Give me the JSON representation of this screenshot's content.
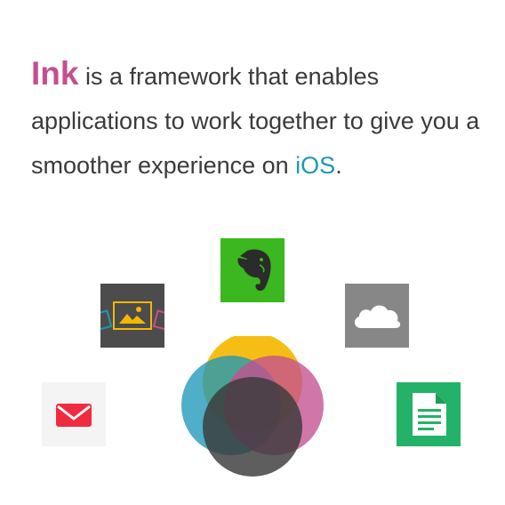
{
  "intro": {
    "brand": "Ink",
    "text_before": " is a framework that enables applications to work together to give you a smoother experience on ",
    "platform": "iOS",
    "text_after": "."
  },
  "apps": [
    {
      "icon": "evernote-elephant-icon"
    },
    {
      "icon": "photos-icon"
    },
    {
      "icon": "cloud-icon"
    },
    {
      "icon": "mail-envelope-icon"
    },
    {
      "icon": "document-icon"
    }
  ],
  "logo": {
    "icon": "ink-overlapping-circles-logo"
  },
  "colors": {
    "brand": "#c44f8f",
    "platform": "#1d97b8",
    "text": "#3a3a3a",
    "evernote": "#3bb71f",
    "photos": "#4c4c4c",
    "cloud": "#878787",
    "mail": "#f4f4f4",
    "docs": "#23b267",
    "circle_yellow": "#f5b800",
    "circle_blue": "#1d97b8",
    "circle_pink": "#c44f8f",
    "circle_gray": "#4a4a4a"
  }
}
